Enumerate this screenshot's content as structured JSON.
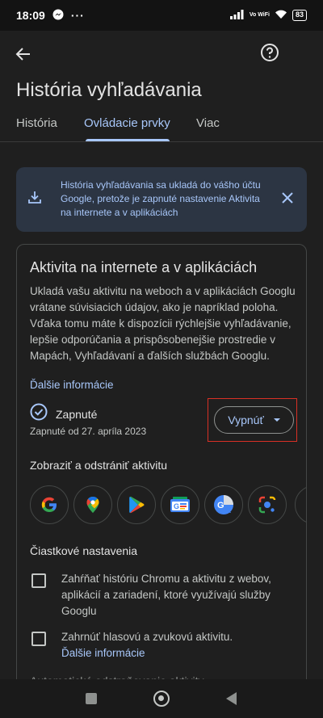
{
  "status_bar": {
    "time": "18:09",
    "network": "Vo WiFi",
    "battery": "83"
  },
  "header": {
    "title": "História vyhľadávania"
  },
  "tabs": [
    {
      "label": "História"
    },
    {
      "label": "Ovládacie prvky",
      "active": true
    },
    {
      "label": "Viac"
    }
  ],
  "banner": {
    "text": "História vyhľadávania sa ukladá do vášho účtu Google, pretože je zapnuté nastavenie Aktivita na internete a v aplikáciách"
  },
  "card": {
    "title": "Aktivita na internete a v aplikáciách",
    "description": "Ukladá vašu aktivitu na weboch a v aplikáciách Googlu vrátane súvisiacich údajov, ako je napríklad poloha. Vďaka tomu máte k dispozícii rýchlejšie vyhľadávanie, lepšie odporúčania a prispôsobenejšie prostredie v Mapách, Vyhľadávaní a ďalších službách Googlu.",
    "more_info": "Ďalšie informácie",
    "status": "Zapnuté",
    "status_date": "Zapnuté od 27. apríla 2023",
    "turn_off_button": "Vypnúť",
    "view_section_title": "Zobraziť a odstrániť aktivitu",
    "apps": [
      "google-icon",
      "maps-icon",
      "play-store-icon",
      "news-icon",
      "translate-icon",
      "lens-icon"
    ],
    "subsettings_title": "Čiastkové nastavenia",
    "subsettings": [
      {
        "label": "Zahŕňať históriu Chromu a aktivitu z webov, aplikácií a zariadení, ktoré využívajú služby Googlu",
        "checked": false
      },
      {
        "label": "Zahrnúť hlasovú a zvukovú aktivitu.",
        "link": "Ďalšie informácie",
        "checked": false
      }
    ],
    "cut_off_text": "Automatické odstraňovanie aktivity"
  },
  "colors": {
    "background": "#1f1f1f",
    "accent": "#a8c7fa",
    "banner_bg": "#2c3543",
    "highlight": "#d93025"
  }
}
